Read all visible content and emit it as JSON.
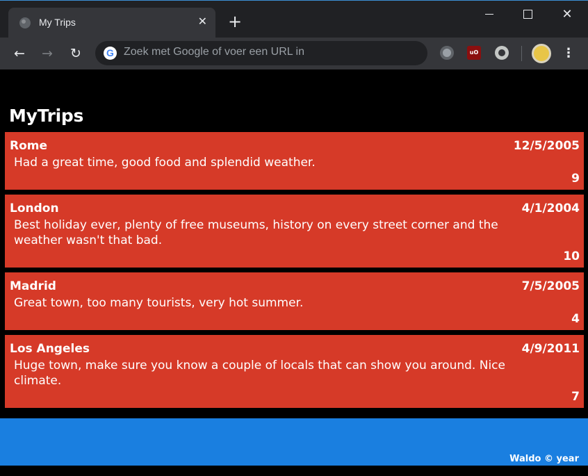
{
  "browser": {
    "tab_title": "My Trips",
    "tab_close": "✕",
    "new_tab": "+",
    "window_close": "✕",
    "back": "←",
    "forward": "→",
    "reload": "↻",
    "omnibox_placeholder": "Zoek met Google of voer een URL in",
    "google_letter": "G",
    "ublock_label": "uO",
    "menu": "⋮"
  },
  "page": {
    "title": "MyTrips",
    "trips": [
      {
        "name": "Rome",
        "date": "12/5/2005",
        "description": "Had a great time, good food and splendid weather.",
        "rating": "9"
      },
      {
        "name": "London",
        "date": "4/1/2004",
        "description": "Best holiday ever, plenty of free museums, history on every street corner and the weather wasn't that bad.",
        "rating": "10"
      },
      {
        "name": "Madrid",
        "date": "7/5/2005",
        "description": "Great town, too many tourists, very hot summer.",
        "rating": "4"
      },
      {
        "name": "Los Angeles",
        "date": "4/9/2011",
        "description": "Huge town, make sure you know a couple of locals that can show you around. Nice climate.",
        "rating": "7"
      }
    ],
    "footer": "Waldo © year"
  },
  "colors": {
    "trip_background": "#d63a28",
    "footer_background": "#1a7fe0",
    "page_background": "#000000"
  }
}
